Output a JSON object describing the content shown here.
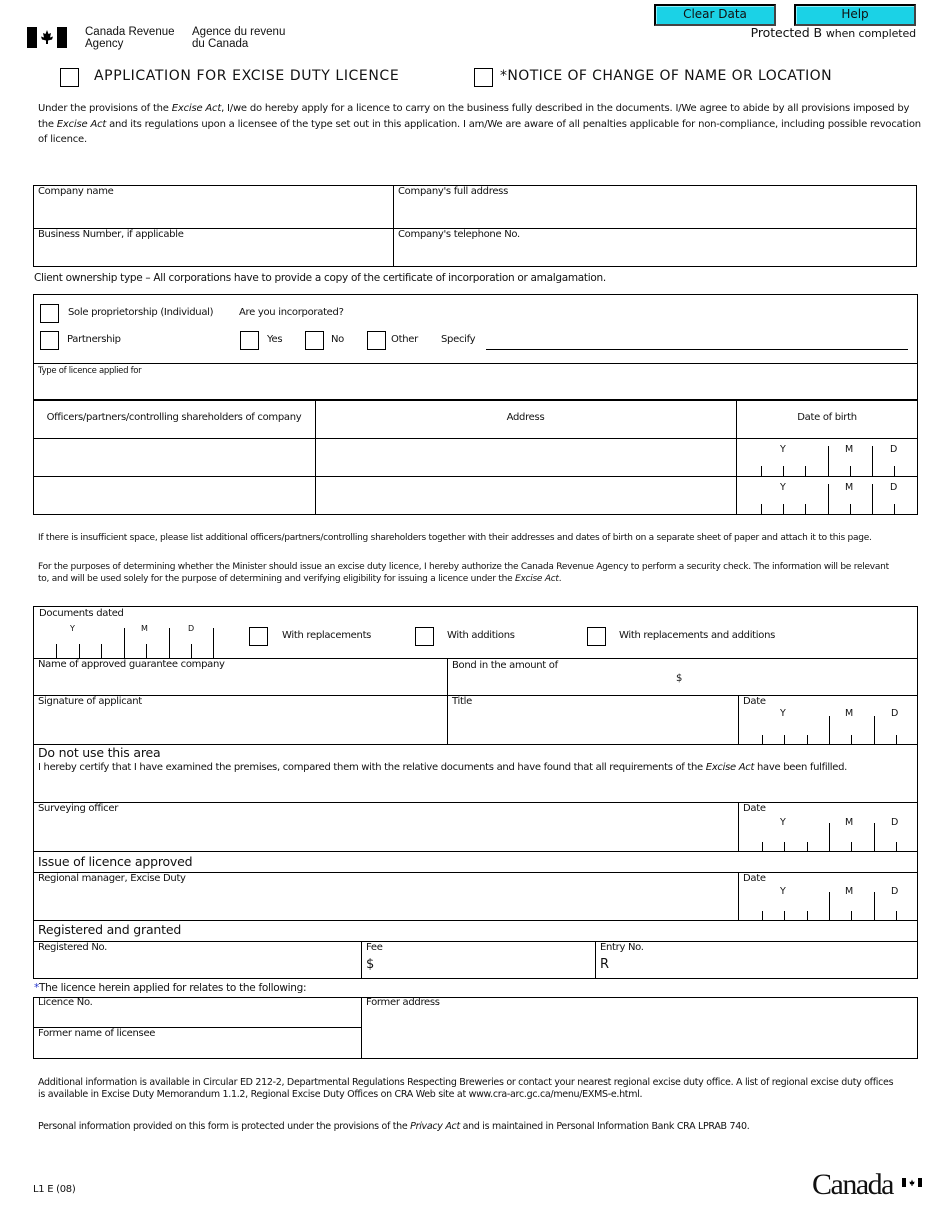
{
  "header": {
    "agency_en_line1": "Canada Revenue",
    "agency_en_line2": "Agency",
    "agency_fr_line1": "Agence du revenu",
    "agency_fr_line2": "du Canada",
    "clear_data_label": "Clear Data",
    "help_label": "Help",
    "protected_label": "Protected B",
    "protected_suffix": "when completed"
  },
  "form_type": {
    "option1_label": "APPLICATION FOR EXCISE DUTY LICENCE",
    "option2_label": "*NOTICE OF CHANGE OF NAME OR LOCATION"
  },
  "intro": {
    "p1_a": "Under the provisions of the ",
    "p1_act": "Excise Act",
    "p1_b": ", I/we do hereby apply for a licence to carry on the business fully described in the documents. I/We agree to abide by all provisions imposed by",
    "p2_a": "the ",
    "p2_act": "Excise Act",
    "p2_b": " and its regulations upon a licensee of the type set out in this application. I am/We are aware of all penalties applicable for non-compliance, including possible revocation",
    "p3": "of licence."
  },
  "company": {
    "name_label": "Company name",
    "address_label": "Company's full address",
    "bn_label": "Business Number, if applicable",
    "phone_label": "Company's telephone No."
  },
  "ownership": {
    "note": "Client ownership type – All corporations have to provide a copy of the certificate of incorporation or amalgamation.",
    "sole_label": "Sole proprietorship (Individual)",
    "incorporated_q": "Are you incorporated?",
    "partnership_label": "Partnership",
    "yes_label": "Yes",
    "no_label": "No",
    "other_label": "Other",
    "specify_label": "Specify",
    "licence_type_label": "Type of licence applied for"
  },
  "officers": {
    "col1": "Officers/partners/controlling shareholders of company",
    "col2": "Address",
    "col3": "Date of birth",
    "date_y": "Y",
    "date_m": "M",
    "date_d": "D"
  },
  "notes": {
    "insufficient": "If there is insufficient space, please list additional officers/partners/controlling shareholders together with their addresses and dates of birth on a separate sheet of paper and attach it to this page.",
    "security_1": "For the purposes of determining whether the Minister should issue an excise duty licence, I hereby authorize the Canada Revenue Agency to perform a security check. The information will be relevant",
    "security_2a": "to, and will be used solely for the purpose of determining and verifying eligibility for issuing a licence under the ",
    "security_2act": "Excise Act",
    "security_2b": "."
  },
  "documents": {
    "dated_label": "Documents dated",
    "with_replacements": "With replacements",
    "with_additions": "With additions",
    "with_both": "With replacements and additions",
    "guarantee_label": "Name of approved guarantee company",
    "bond_label": "Bond in the amount of",
    "bond_currency": "$",
    "signature_label": "Signature of applicant",
    "title_label": "Title",
    "date_label": "Date"
  },
  "office": {
    "do_not_use": "Do not use this area",
    "certify_a": "I hereby certify that I have examined the premises, compared them with the relative documents and have found that all requirements of the ",
    "certify_act": "Excise Act",
    "certify_b": " have been fulfilled.",
    "surveying_officer": "Surveying officer",
    "issue_approved": "Issue of licence approved",
    "regional_manager": "Regional manager, Excise Duty",
    "registered_granted": "Registered and granted",
    "registered_no": "Registered No.",
    "fee_label": "Fee",
    "fee_prefix": "$",
    "entry_label": "Entry No.",
    "entry_prefix": "R",
    "date_label": "Date"
  },
  "change": {
    "asterisk": "*",
    "relates": "The licence herein applied for relates to the following:",
    "licence_no": "Licence No.",
    "former_address": "Former address",
    "former_name": "Former name of licensee"
  },
  "footer": {
    "additional_1": "Additional information is available in Circular ED 212-2, Departmental Regulations Respecting Breweries or contact your nearest regional excise duty office. A list of regional excise duty offices",
    "additional_2": "is available in Excise Duty Memorandum 1.1.2, Regional Excise Duty Offices on CRA Web site at www.cra-arc.gc.ca/menu/EXMS-e.html.",
    "privacy_a": "Personal information provided on this form is protected under the provisions of the ",
    "privacy_act": "Privacy Act",
    "privacy_b": " and is maintained in Personal Information Bank CRA LPRAB 740.",
    "form_code": "L1 E (08)",
    "wordmark": "Canada"
  },
  "colors": {
    "button_bg": "#1bd2e6",
    "asterisk_blue": "#2233cc"
  }
}
